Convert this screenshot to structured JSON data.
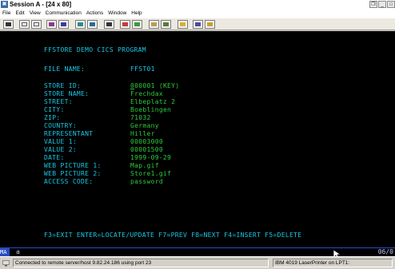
{
  "window": {
    "title": "Session A - [24 x 80]",
    "controls": [
      "restore",
      "minimize",
      "close"
    ]
  },
  "menu": [
    "File",
    "Edit",
    "View",
    "Communication",
    "Actions",
    "Window",
    "Help"
  ],
  "toolbar": {
    "icons": [
      "print-screen-icon",
      "copy-icon",
      "paste-icon",
      "send-file-icon",
      "receive-file-icon",
      "display-setup-icon",
      "keyboard-map-icon",
      "macro-icon",
      "record-macro-icon",
      "play-macro-icon",
      "transfer-icon",
      "color-map-icon",
      "help-icon",
      "edit-icon"
    ]
  },
  "terminal": {
    "heading": "FFSTORE DEMO CICS PROGRAM",
    "file_name_label": "FILE NAME:",
    "file_name_value": "FFST01",
    "fields": [
      {
        "label": "STORE ID:",
        "value": "000001 (KEY)"
      },
      {
        "label": "STORE NAME:",
        "value": "Frechdax"
      },
      {
        "label": "STREET:",
        "value": "Elbeplatz 2"
      },
      {
        "label": "CITY:",
        "value": "Boeblingen"
      },
      {
        "label": "ZIP:",
        "value": "71032"
      },
      {
        "label": "COUNTRY:",
        "value": "Germany"
      },
      {
        "label": "REPRESENTANT",
        "value": "Hiller"
      },
      {
        "label": "VALUE 1:",
        "value": "00003000"
      },
      {
        "label": "VALUE 2:",
        "value": "00001500"
      },
      {
        "label": "DATE:",
        "value": "1999-09-29"
      },
      {
        "label": "WEB PICTURE 1:",
        "value": "Map.gif"
      },
      {
        "label": "WEB PICTURE 2:",
        "value": "Store1.gif"
      },
      {
        "label": "ACCESS CODE:",
        "value": "password"
      }
    ],
    "function_keys": "F3=EXIT ENTER=LOCATE/UPDATE F7=PREV F8=NEXT F4=INSERT F5=DELETE"
  },
  "oia": {
    "mode": "MA",
    "session": "a",
    "cursor_pos": "06/0"
  },
  "status": {
    "connection": "Connected to remote server/host 9.82.24.186 using port 23",
    "printer": "IBM 4019 LaserPrinter on LPT1:"
  },
  "colors": {
    "label": "#19c8e6",
    "value": "#2ecc3a",
    "background": "#000000",
    "oia_accent": "#2a4cc0"
  }
}
